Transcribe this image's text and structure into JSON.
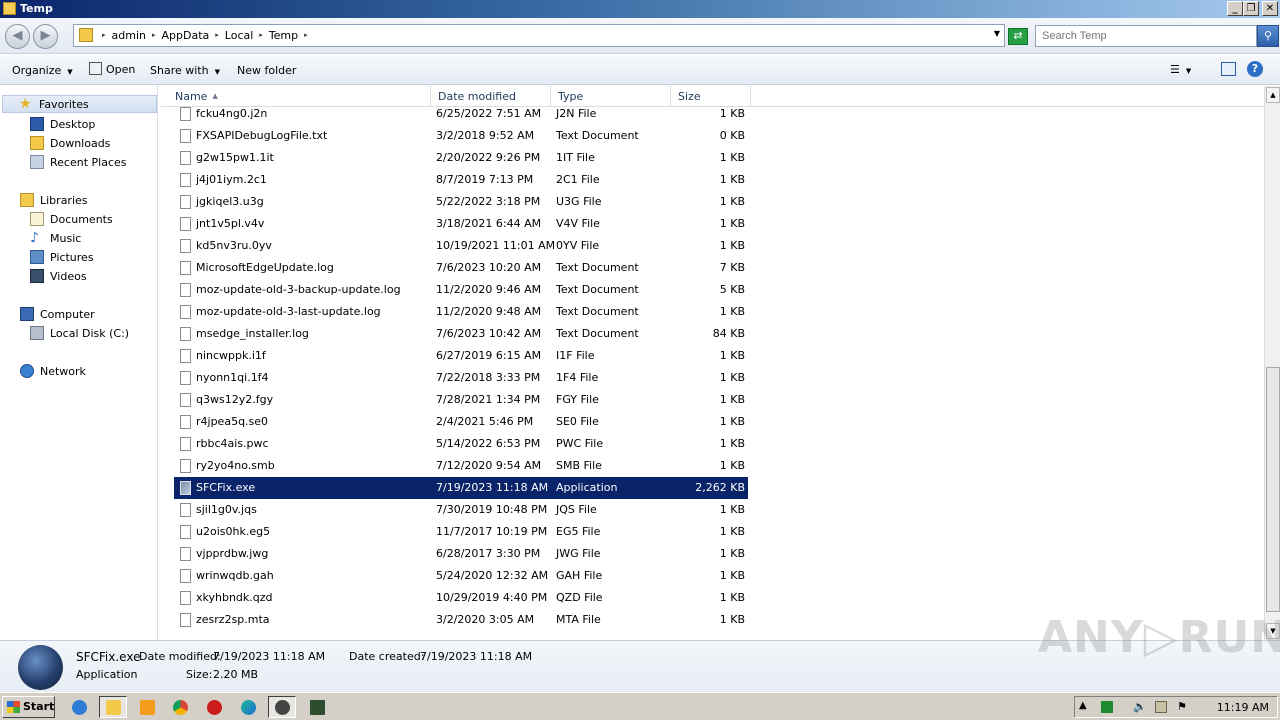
{
  "window": {
    "title": "Temp",
    "controls": {
      "minimize": "_",
      "restore": "❐",
      "close": "✕"
    }
  },
  "nav": {
    "back_icon": "back-arrow-icon",
    "forward_icon": "forward-arrow-icon"
  },
  "address": {
    "crumbs": [
      "admin",
      "AppData",
      "Local",
      "Temp"
    ]
  },
  "search": {
    "placeholder": "Search Temp"
  },
  "toolbar": {
    "organize": "Organize",
    "open": "Open",
    "share_with": "Share with",
    "new_folder": "New folder"
  },
  "navpane": {
    "favorites": "Favorites",
    "desktop": "Desktop",
    "downloads": "Downloads",
    "recent_places": "Recent Places",
    "libraries": "Libraries",
    "documents": "Documents",
    "music": "Music",
    "pictures": "Pictures",
    "videos": "Videos",
    "computer": "Computer",
    "local_disk": "Local Disk (C:)",
    "network": "Network"
  },
  "columns": {
    "name": "Name",
    "date": "Date modified",
    "type": "Type",
    "size": "Size"
  },
  "files": [
    {
      "name": "fcku4ng0.j2n",
      "date": "6/25/2022 7:51 AM",
      "type": "J2N File",
      "size": "1 KB"
    },
    {
      "name": "FXSAPIDebugLogFile.txt",
      "date": "3/2/2018 9:52 AM",
      "type": "Text Document",
      "size": "0 KB"
    },
    {
      "name": "g2w15pw1.1it",
      "date": "2/20/2022 9:26 PM",
      "type": "1IT File",
      "size": "1 KB"
    },
    {
      "name": "j4j01iym.2c1",
      "date": "8/7/2019 7:13 PM",
      "type": "2C1 File",
      "size": "1 KB"
    },
    {
      "name": "jgkiqel3.u3g",
      "date": "5/22/2022 3:18 PM",
      "type": "U3G File",
      "size": "1 KB"
    },
    {
      "name": "jnt1v5pl.v4v",
      "date": "3/18/2021 6:44 AM",
      "type": "V4V File",
      "size": "1 KB"
    },
    {
      "name": "kd5nv3ru.0yv",
      "date": "10/19/2021 11:01 AM",
      "type": "0YV File",
      "size": "1 KB"
    },
    {
      "name": "MicrosoftEdgeUpdate.log",
      "date": "7/6/2023 10:20 AM",
      "type": "Text Document",
      "size": "7 KB"
    },
    {
      "name": "moz-update-old-3-backup-update.log",
      "date": "11/2/2020 9:46 AM",
      "type": "Text Document",
      "size": "5 KB"
    },
    {
      "name": "moz-update-old-3-last-update.log",
      "date": "11/2/2020 9:48 AM",
      "type": "Text Document",
      "size": "1 KB"
    },
    {
      "name": "msedge_installer.log",
      "date": "7/6/2023 10:42 AM",
      "type": "Text Document",
      "size": "84 KB"
    },
    {
      "name": "nincwppk.i1f",
      "date": "6/27/2019 6:15 AM",
      "type": "I1F File",
      "size": "1 KB"
    },
    {
      "name": "nyonn1qi.1f4",
      "date": "7/22/2018 3:33 PM",
      "type": "1F4 File",
      "size": "1 KB"
    },
    {
      "name": "q3ws12y2.fgy",
      "date": "7/28/2021 1:34 PM",
      "type": "FGY File",
      "size": "1 KB"
    },
    {
      "name": "r4jpea5q.se0",
      "date": "2/4/2021 5:46 PM",
      "type": "SE0 File",
      "size": "1 KB"
    },
    {
      "name": "rbbc4ais.pwc",
      "date": "5/14/2022 6:53 PM",
      "type": "PWC File",
      "size": "1 KB"
    },
    {
      "name": "ry2yo4no.smb",
      "date": "7/12/2020 9:54 AM",
      "type": "SMB File",
      "size": "1 KB"
    },
    {
      "name": "SFCFix.exe",
      "date": "7/19/2023 11:18 AM",
      "type": "Application",
      "size": "2,262 KB"
    },
    {
      "name": "sjil1g0v.jqs",
      "date": "7/30/2019 10:48 PM",
      "type": "JQS File",
      "size": "1 KB"
    },
    {
      "name": "u2ois0hk.eg5",
      "date": "11/7/2017 10:19 PM",
      "type": "EG5 File",
      "size": "1 KB"
    },
    {
      "name": "vjpprdbw.jwg",
      "date": "6/28/2017 3:30 PM",
      "type": "JWG File",
      "size": "1 KB"
    },
    {
      "name": "wrinwqdb.gah",
      "date": "5/24/2020 12:32 AM",
      "type": "GAH File",
      "size": "1 KB"
    },
    {
      "name": "xkyhbndk.qzd",
      "date": "10/29/2019 4:40 PM",
      "type": "QZD File",
      "size": "1 KB"
    },
    {
      "name": "zesrz2sp.mta",
      "date": "3/2/2020 3:05 AM",
      "type": "MTA File",
      "size": "1 KB"
    }
  ],
  "selected_index": 17,
  "details": {
    "name": "SFCFix.exe",
    "type": "Application",
    "modified_label": "Date modified:",
    "modified": "7/19/2023 11:18 AM",
    "created_label": "Date created:",
    "created": "7/19/2023 11:18 AM",
    "size_label": "Size:",
    "size": "2.20 MB"
  },
  "watermark": "ANY▷RUN",
  "taskbar": {
    "start": "Start",
    "clock": "11:19 AM",
    "apps": [
      "internet-explorer-icon",
      "explorer-icon",
      "media-player-icon",
      "chrome-icon",
      "opera-icon",
      "edge-icon",
      "sfcfix-icon",
      "terminal-icon"
    ]
  },
  "colors": {
    "selection": "#0a246a",
    "title_start": "#0a246a",
    "title_end": "#a6caf0"
  }
}
